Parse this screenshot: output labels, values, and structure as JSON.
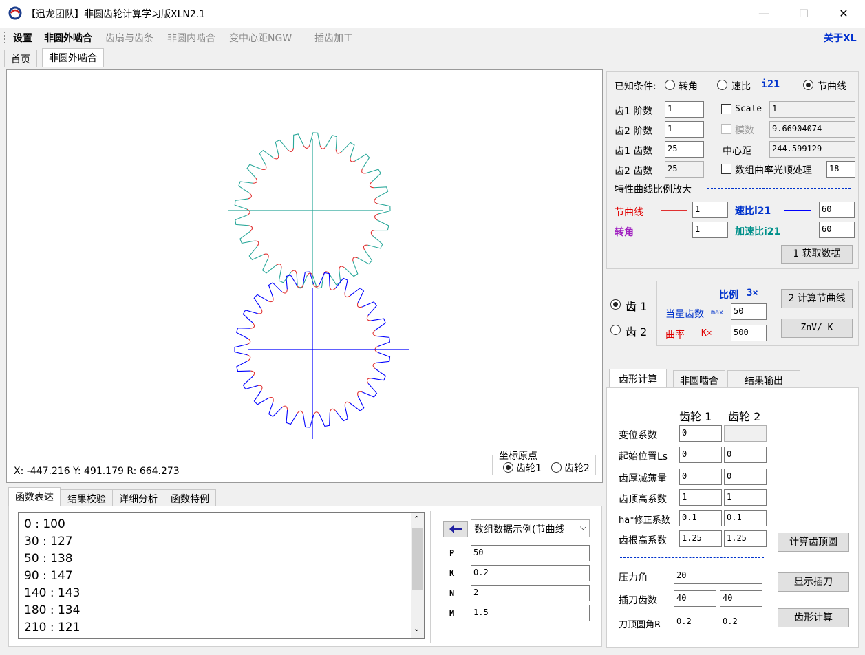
{
  "window": {
    "title": "【迅龙团队】非圆齿轮计算学习版XLN2.1",
    "minimize": "—",
    "maximize": "☐",
    "close": "✕"
  },
  "menu": {
    "items": [
      "设置",
      "非圆外啮合",
      "齿扇与齿条",
      "非圆内啮合",
      "变中心距NGW",
      "插齿加工"
    ],
    "about": "关于XL"
  },
  "tabs": [
    "首页",
    "非圆外啮合"
  ],
  "canvas": {
    "coords": "X: -447.216 Y: 491.179  R: 664.273",
    "origin_group": "坐标原点",
    "origin_gear1": "齿轮1",
    "origin_gear2": "齿轮2",
    "gear1_teeth": 25,
    "gear2_teeth": 25
  },
  "conditions": {
    "label": "已知条件:",
    "opt_angle": "转角",
    "opt_speed": "速比",
    "speed_suffix": "i21",
    "opt_pitch": "节曲线"
  },
  "params": {
    "g1_order_label": "齿1 阶数",
    "g1_order": "1",
    "g2_order_label": "齿2 阶数",
    "g2_order": "1",
    "g1_teeth_label": "齿1 齿数",
    "g1_teeth": "25",
    "g2_teeth_label": "齿2 齿数",
    "g2_teeth": "25",
    "scale_label": "Scale",
    "scale": "1",
    "module_label": "模数",
    "module": "9.66904074",
    "center_label": "中心距",
    "center": "244.599129",
    "smooth_label": "数组曲率光顺处理",
    "smooth": "18",
    "curve_scale_label": "特性曲线比例放大"
  },
  "curves": {
    "pitch_label": "节曲线",
    "pitch_val": "1",
    "speed_label": "速比i21",
    "speed_val": "60",
    "angle_label": "转角",
    "angle_val": "1",
    "accel_label": "加速比i21",
    "accel_val": "60",
    "get_data": "1 获取数据"
  },
  "ratio": {
    "gear1": "齿 1",
    "gear2": "齿 2",
    "ratio_label": "比例",
    "ratio_value": "3×",
    "equiv_teeth_label": "当量齿数",
    "max_label": "max",
    "equiv_teeth": "50",
    "curvature_label": "曲率",
    "k_label": "K×",
    "curvature": "500",
    "calc_pitch": "2 计算节曲线",
    "znv_k": "ZnV/ K"
  },
  "bottom_tabs": [
    "函数表达",
    "结果校验",
    "详细分析",
    "函数特例"
  ],
  "function_lines": [
    "0 : 100",
    "30 : 127",
    "50 : 138",
    "90 : 147",
    "140 : 143",
    "180 : 134",
    "210 : 121"
  ],
  "example": {
    "select": "数组数据示例(节曲线",
    "p_label": "P",
    "p": "50",
    "k_label": "K",
    "k": "0.2",
    "n_label": "N",
    "n": "2",
    "m_label": "M",
    "m": "1.5"
  },
  "right_tabs": [
    "齿形计算",
    "非圆啮合",
    "结果输出"
  ],
  "tooth": {
    "gear1_header": "齿轮 1",
    "gear2_header": "齿轮 2",
    "rows": [
      {
        "label": "变位系数",
        "g1": "0",
        "g2": ""
      },
      {
        "label": "起始位置Ls",
        "g1": "0",
        "g2": "0"
      },
      {
        "label": "齿厚减薄量",
        "g1": "0",
        "g2": "0"
      },
      {
        "label": "齿顶高系数",
        "g1": "1",
        "g2": "1"
      },
      {
        "label": "ha*修正系数",
        "g1": "0.1",
        "g2": "0.1"
      },
      {
        "label": "齿根高系数",
        "g1": "1.25",
        "g2": "1.25"
      }
    ],
    "pressure_label": "压力角",
    "pressure": "20",
    "cutter_teeth_label": "插刀齿数",
    "cutter_teeth_1": "40",
    "cutter_teeth_2": "40",
    "tip_radius_label": "刀顶圆角R",
    "tip_radius_1": "0.2",
    "tip_radius_2": "0.2",
    "btn_tip_circle": "计算齿顶圆",
    "btn_show_cutter": "显示插刀",
    "btn_tooth_calc": "齿形计算"
  },
  "colors": {
    "teal": "#2aa89a",
    "blue": "#0000ff",
    "red": "#e03030",
    "purple": "#a020c0",
    "label_blue": "#0033cc",
    "label_red": "#e00000"
  }
}
